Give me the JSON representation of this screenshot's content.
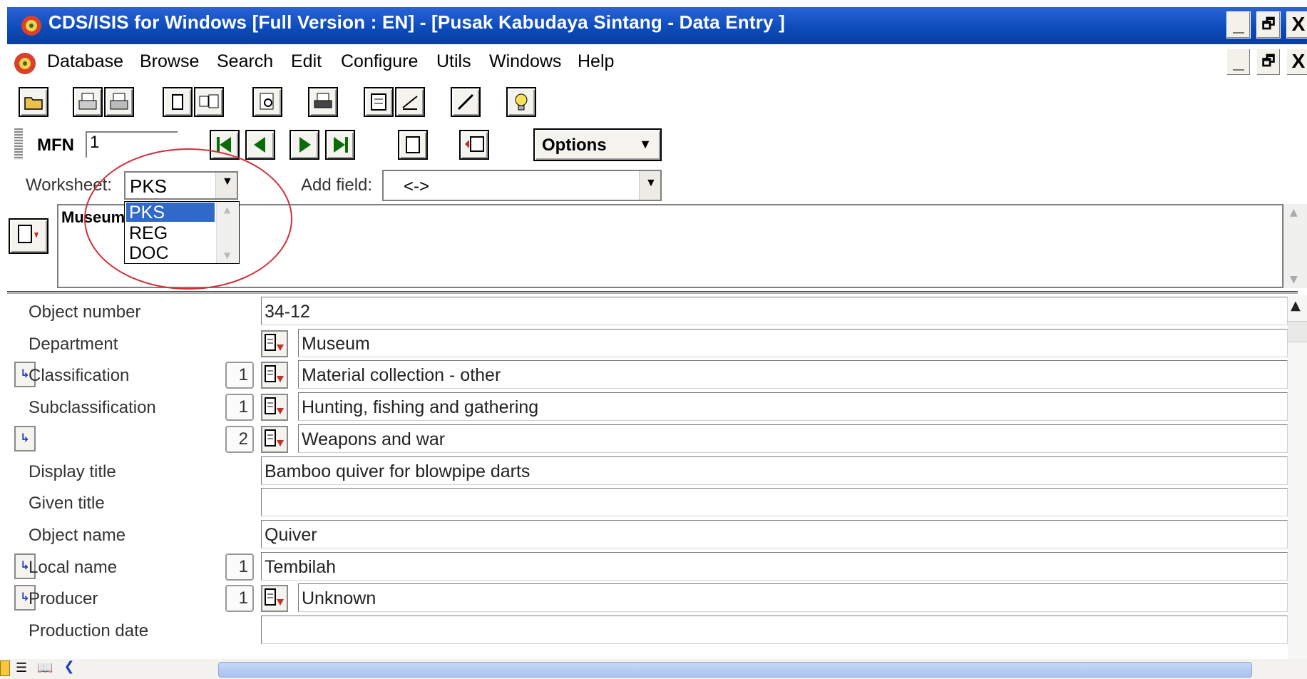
{
  "window": {
    "title": "CDS/ISIS for Windows [Full Version : EN] - [Pusak Kabudaya Sintang - Data Entry ]",
    "controls": {
      "minimize": "_",
      "restore": "▭",
      "close": "X"
    }
  },
  "menu": {
    "items": [
      "Database",
      "Browse",
      "Search",
      "Edit",
      "Configure",
      "Utils",
      "Windows",
      "Help"
    ]
  },
  "toolbar": {
    "icons": [
      "open-folder-icon",
      "print-preview-icon",
      "print-alt-icon",
      "clipboard-icon",
      "copy-icon",
      "preview-icon",
      "print-icon",
      "form-icon",
      "edit-tools-icon",
      "pencil-icon",
      "lightbulb-icon"
    ]
  },
  "nav": {
    "mfn_label": "MFN",
    "mfn_value": "1",
    "options_label": "Options"
  },
  "worksheet": {
    "label": "Worksheet:",
    "selected": "PKS",
    "options": [
      "PKS",
      "REG",
      "DOC"
    ],
    "add_field_label": "Add field:",
    "add_field_value": "<->"
  },
  "display": {
    "text": "Museum"
  },
  "fields": [
    {
      "label": "Object number",
      "occ": "",
      "picker": false,
      "repeat": false,
      "value": "34-12"
    },
    {
      "label": "Department",
      "occ": "",
      "picker": true,
      "repeat": false,
      "value": "Museum"
    },
    {
      "label": "Classification",
      "occ": "1",
      "picker": true,
      "repeat": true,
      "value": "Material collection - other"
    },
    {
      "label": "Subclassification",
      "occ": "1",
      "picker": true,
      "repeat": false,
      "value": "Hunting, fishing and gathering"
    },
    {
      "label": "",
      "occ": "2",
      "picker": true,
      "repeat": true,
      "value": "Weapons and war"
    },
    {
      "label": "Display title",
      "occ": "",
      "picker": false,
      "repeat": false,
      "value": "Bamboo quiver for blowpipe darts"
    },
    {
      "label": "Given title",
      "occ": "",
      "picker": false,
      "repeat": false,
      "value": ""
    },
    {
      "label": "Object name",
      "occ": "",
      "picker": false,
      "repeat": false,
      "value": "Quiver"
    },
    {
      "label": "Local name",
      "occ": "1",
      "picker": false,
      "repeat": true,
      "value": "Tembilah"
    },
    {
      "label": "Producer",
      "occ": "1",
      "picker": true,
      "repeat": true,
      "value": "Unknown"
    },
    {
      "label": "Production date",
      "occ": "",
      "picker": false,
      "repeat": false,
      "value": ""
    }
  ],
  "colors": {
    "titlebar": "#0b4ab8",
    "selection": "#3169c6",
    "annotation": "#d0303a"
  }
}
